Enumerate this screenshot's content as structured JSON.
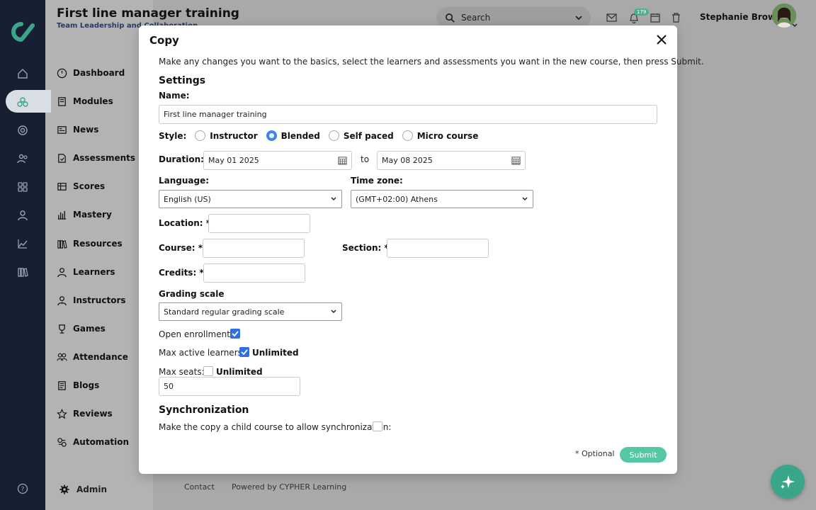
{
  "header": {
    "title": "First line manager training",
    "subtitle": "Team Leadership and Collaboration",
    "search_placeholder": "Search",
    "notification_count": "179",
    "user_name": "Stephanie Brown"
  },
  "nav": {
    "items": [
      "Dashboard",
      "Modules",
      "News",
      "Assessments",
      "Scores",
      "Mastery",
      "Resources",
      "Learners",
      "Instructors",
      "Games",
      "Attendance",
      "Blogs",
      "Reviews",
      "Automation"
    ],
    "admin": "Admin"
  },
  "footer": {
    "contact": "Contact",
    "powered": "Powered by CYPHER Learning"
  },
  "modal": {
    "title": "Copy",
    "intro": "Make any changes you want to the basics, select the learners and assessments you want in the new course, then press Submit.",
    "settings_heading": "Settings",
    "name_label": "Name:",
    "name_value": "First line manager training",
    "style_label": "Style:",
    "style_options": [
      "Instructor",
      "Blended",
      "Self paced",
      "Micro course"
    ],
    "style_selected": "Blended",
    "duration_label": "Duration:",
    "duration_from": "May 01 2025",
    "duration_to_label": "to",
    "duration_to": "May 08 2025",
    "language_label": "Language:",
    "language_value": "English (US)",
    "timezone_label": "Time zone:",
    "timezone_value": "(GMT+02:00) Athens",
    "location_label": "Location: *",
    "course_label": "Course: *",
    "section_label": "Section: *",
    "credits_label": "Credits: *",
    "grading_label": "Grading scale",
    "grading_value": "Standard regular grading scale",
    "open_enrollment_label": "Open enrollment:",
    "open_enrollment_checked": true,
    "max_active_label": "Max active learners:",
    "max_active_unlimited_label": "Unlimited",
    "max_active_unlimited_checked": true,
    "max_seats_label": "Max seats:",
    "max_seats_unlimited_label": "Unlimited",
    "max_seats_unlimited_checked": false,
    "max_seats_value": "50",
    "sync_heading": "Synchronization",
    "sync_label": "Make the copy a child course to allow synchronization:",
    "sync_checked": false,
    "optional_note": "* Optional",
    "submit_label": "Submit"
  },
  "colors": {
    "rail_bg": "#172033",
    "accent_green": "#56c7a5",
    "checkbox_blue": "#2f6fe0",
    "radio_blue": "#3b82f6"
  }
}
